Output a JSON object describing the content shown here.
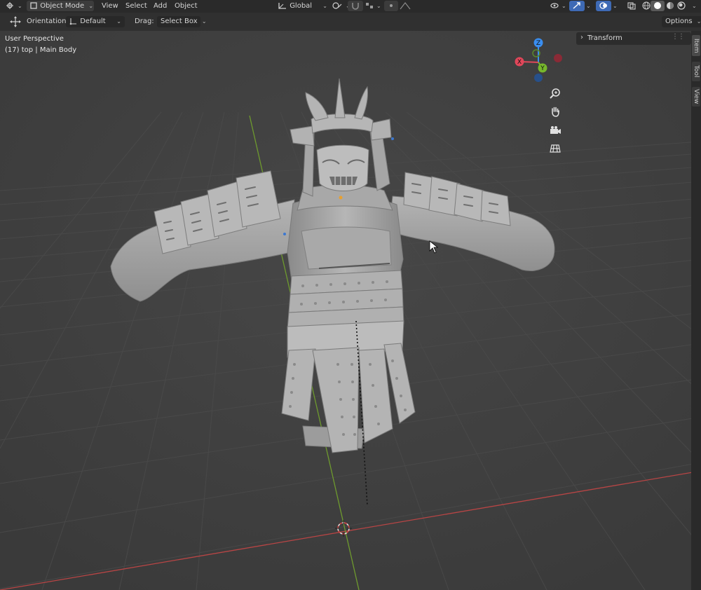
{
  "header": {
    "mode_label": "Object Mode",
    "menu": [
      "View",
      "Select",
      "Add",
      "Object"
    ],
    "orientation_global": "Global",
    "options_label": "Options"
  },
  "toolbar": {
    "orientation_label": "Orientation:",
    "orientation_value": "Default",
    "drag_label": "Drag:",
    "drag_value": "Select Box"
  },
  "viewport": {
    "perspective": "User Perspective",
    "object_info": "(17) top | Main Body"
  },
  "sidepanel": {
    "transform_label": "Transform",
    "tabs": [
      "Item",
      "Tool",
      "View"
    ]
  },
  "gizmo": {
    "x_label": "X",
    "y_label": "Y",
    "z_label": "Z",
    "x_color": "#e0475a",
    "y_color": "#77b82c",
    "z_color": "#3a8ef0"
  },
  "icons": [
    "editor-type-icon",
    "object-mode-icon",
    "transform-pivot-icon",
    "snap-icon",
    "proportional-edit-icon",
    "visibility-icon",
    "gizmo-toggle-icon",
    "overlay-icon",
    "xray-icon",
    "wireframe-shading-icon",
    "solid-shading-icon",
    "material-shading-icon",
    "rendered-shading-icon",
    "transform-tool-icon",
    "zoom-icon",
    "pan-hand-icon",
    "camera-icon",
    "ortho-grid-icon",
    "3d-cursor-icon"
  ]
}
